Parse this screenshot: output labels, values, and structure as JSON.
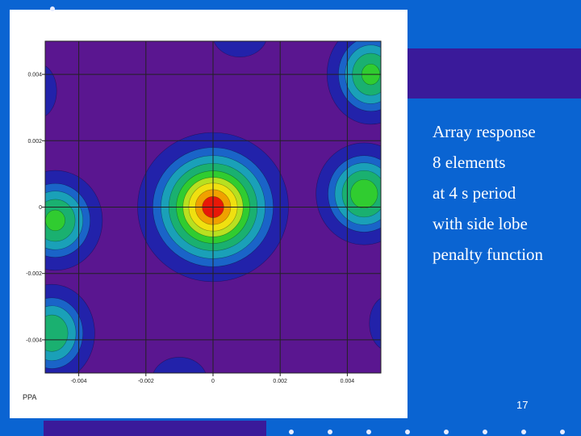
{
  "slide": {
    "bullets": [
      "Array response",
      "8 elements",
      "at 4 s period",
      "with side lobe",
      "penalty function"
    ],
    "slide_number": "17",
    "corner_label": "PPA"
  },
  "colors": {
    "background": "#0a64d2",
    "accent": "#3a1a9a",
    "plot_background": "#5a1690",
    "contour_levels": [
      "#5a1690",
      "#2222aa",
      "#1a64c8",
      "#1aa0b8",
      "#1ab070",
      "#30cc30",
      "#b8e020",
      "#f0e010",
      "#f0a000",
      "#e81808"
    ]
  },
  "chart_data": {
    "type": "heatmap",
    "x_ticks": [
      "-0.004",
      "-0.002",
      "0",
      "0.002",
      "0.004"
    ],
    "y_ticks": [
      "0.004",
      "0.002",
      "0",
      "-0.002",
      "-0.004"
    ],
    "x_tick_values": [
      -0.004,
      -0.002,
      0,
      0.002,
      0.004
    ],
    "y_tick_values": [
      0.004,
      0.002,
      0,
      -0.002,
      -0.004
    ],
    "xlim": [
      -0.005,
      0.005
    ],
    "ylim": [
      -0.005,
      0.005
    ],
    "grid": true,
    "peaks": [
      {
        "name": "main-lobe",
        "x": 0,
        "y": 0,
        "level": 1.0,
        "sx": 0.001,
        "sy": 0.001
      },
      {
        "name": "side-lobe-upper-right",
        "x": 0.0047,
        "y": 0.004,
        "level": 0.6,
        "sx": 0.00065,
        "sy": 0.00075
      },
      {
        "name": "side-lobe-right",
        "x": 0.0045,
        "y": 0.0004,
        "level": 0.65,
        "sx": 0.0007,
        "sy": 0.00075
      },
      {
        "name": "side-lobe-left",
        "x": -0.0047,
        "y": -0.0004,
        "level": 0.6,
        "sx": 0.0007,
        "sy": 0.00075
      },
      {
        "name": "side-lobe-lower-left",
        "x": -0.0048,
        "y": -0.0038,
        "level": 0.55,
        "sx": 0.00065,
        "sy": 0.00075
      },
      {
        "name": "minor-lobe-top",
        "x": 0.0008,
        "y": 0.0052,
        "level": 0.2,
        "sx": 0.0006,
        "sy": 0.0005
      },
      {
        "name": "minor-lobe-bottom",
        "x": -0.001,
        "y": -0.0052,
        "level": 0.2,
        "sx": 0.0006,
        "sy": 0.0005
      },
      {
        "name": "minor-lobe-upper-left",
        "x": -0.0052,
        "y": 0.0035,
        "level": 0.2,
        "sx": 0.0004,
        "sy": 0.0006
      },
      {
        "name": "minor-lobe-lower-right",
        "x": 0.0052,
        "y": -0.0035,
        "level": 0.2,
        "sx": 0.0004,
        "sy": 0.0006
      }
    ]
  }
}
